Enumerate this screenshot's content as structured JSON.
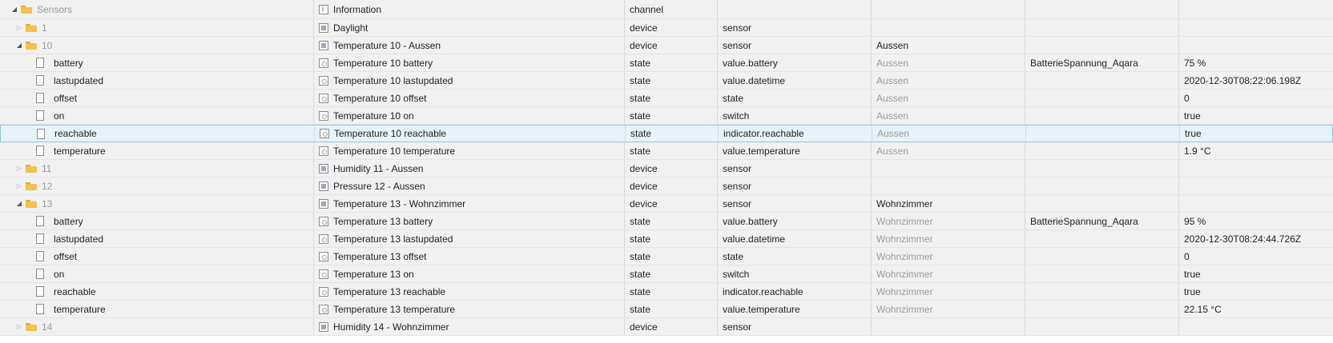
{
  "rows": [
    {
      "kind": "folder",
      "level": 0,
      "expanded": true,
      "name": "Sensors",
      "name_muted": true,
      "icon": "info",
      "title": "Information",
      "type": "channel",
      "role": "",
      "room": "",
      "func": "",
      "value": ""
    },
    {
      "kind": "folder",
      "level": 1,
      "expanded": false,
      "name": "1",
      "name_muted": true,
      "icon": "dev",
      "title": "Daylight",
      "type": "device",
      "role": "sensor",
      "room": "",
      "func": "",
      "value": ""
    },
    {
      "kind": "folder",
      "level": 1,
      "expanded": true,
      "name": "10",
      "name_muted": true,
      "icon": "dev",
      "title": "Temperature 10 - Aussen",
      "type": "device",
      "role": "sensor",
      "room": "Aussen",
      "func": "",
      "value": ""
    },
    {
      "kind": "file",
      "level": 2,
      "name": "battery",
      "icon": "state",
      "title": "Temperature 10 battery",
      "type": "state",
      "role": "value.battery",
      "room": "Aussen",
      "room_muted": true,
      "func": "BatterieSpannung_Aqara",
      "value": "75 %"
    },
    {
      "kind": "file",
      "level": 2,
      "name": "lastupdated",
      "icon": "state",
      "title": "Temperature 10 lastupdated",
      "type": "state",
      "role": "value.datetime",
      "room": "Aussen",
      "room_muted": true,
      "func": "",
      "value": "2020-12-30T08:22:06.198Z"
    },
    {
      "kind": "file",
      "level": 2,
      "name": "offset",
      "icon": "state",
      "title": "Temperature 10 offset",
      "type": "state",
      "role": "state",
      "room": "Aussen",
      "room_muted": true,
      "func": "",
      "value": "0"
    },
    {
      "kind": "file",
      "level": 2,
      "name": "on",
      "icon": "state",
      "title": "Temperature 10 on",
      "type": "state",
      "role": "switch",
      "room": "Aussen",
      "room_muted": true,
      "func": "",
      "value": "true"
    },
    {
      "kind": "file",
      "level": 2,
      "selected": true,
      "name": "reachable",
      "icon": "state",
      "title": "Temperature 10 reachable",
      "type": "state",
      "role": "indicator.reachable",
      "room": "Aussen",
      "room_muted": true,
      "func": "",
      "value": "true"
    },
    {
      "kind": "file",
      "level": 2,
      "name": "temperature",
      "icon": "state",
      "title": "Temperature 10 temperature",
      "type": "state",
      "role": "value.temperature",
      "room": "Aussen",
      "room_muted": true,
      "func": "",
      "value": "1.9 °C"
    },
    {
      "kind": "folder",
      "level": 1,
      "expanded": false,
      "name": "11",
      "name_muted": true,
      "icon": "dev",
      "title": "Humidity 11 - Aussen",
      "type": "device",
      "role": "sensor",
      "room": "",
      "func": "",
      "value": ""
    },
    {
      "kind": "folder",
      "level": 1,
      "expanded": false,
      "name": "12",
      "name_muted": true,
      "icon": "dev",
      "title": "Pressure 12 - Aussen",
      "type": "device",
      "role": "sensor",
      "room": "",
      "func": "",
      "value": ""
    },
    {
      "kind": "folder",
      "level": 1,
      "expanded": true,
      "name": "13",
      "name_muted": true,
      "icon": "dev",
      "title": "Temperature 13 - Wohnzimmer",
      "type": "device",
      "role": "sensor",
      "room": "Wohnzimmer",
      "func": "",
      "value": ""
    },
    {
      "kind": "file",
      "level": 2,
      "name": "battery",
      "icon": "state",
      "title": "Temperature 13 battery",
      "type": "state",
      "role": "value.battery",
      "room": "Wohnzimmer",
      "room_muted": true,
      "func": "BatterieSpannung_Aqara",
      "value": "95 %"
    },
    {
      "kind": "file",
      "level": 2,
      "name": "lastupdated",
      "icon": "state",
      "title": "Temperature 13 lastupdated",
      "type": "state",
      "role": "value.datetime",
      "room": "Wohnzimmer",
      "room_muted": true,
      "func": "",
      "value": "2020-12-30T08:24:44.726Z"
    },
    {
      "kind": "file",
      "level": 2,
      "name": "offset",
      "icon": "state",
      "title": "Temperature 13 offset",
      "type": "state",
      "role": "state",
      "room": "Wohnzimmer",
      "room_muted": true,
      "func": "",
      "value": "0"
    },
    {
      "kind": "file",
      "level": 2,
      "name": "on",
      "icon": "state",
      "title": "Temperature 13 on",
      "type": "state",
      "role": "switch",
      "room": "Wohnzimmer",
      "room_muted": true,
      "func": "",
      "value": "true"
    },
    {
      "kind": "file",
      "level": 2,
      "name": "reachable",
      "icon": "state",
      "title": "Temperature 13 reachable",
      "type": "state",
      "role": "indicator.reachable",
      "room": "Wohnzimmer",
      "room_muted": true,
      "func": "",
      "value": "true"
    },
    {
      "kind": "file",
      "level": 2,
      "name": "temperature",
      "icon": "state",
      "title": "Temperature 13 temperature",
      "type": "state",
      "role": "value.temperature",
      "room": "Wohnzimmer",
      "room_muted": true,
      "func": "",
      "value": "22.15 °C"
    },
    {
      "kind": "folder",
      "level": 1,
      "expanded": false,
      "name": "14",
      "name_muted": true,
      "icon": "dev",
      "title": "Humidity 14 - Wohnzimmer",
      "type": "device",
      "role": "sensor",
      "room": "",
      "func": "",
      "value": ""
    }
  ]
}
